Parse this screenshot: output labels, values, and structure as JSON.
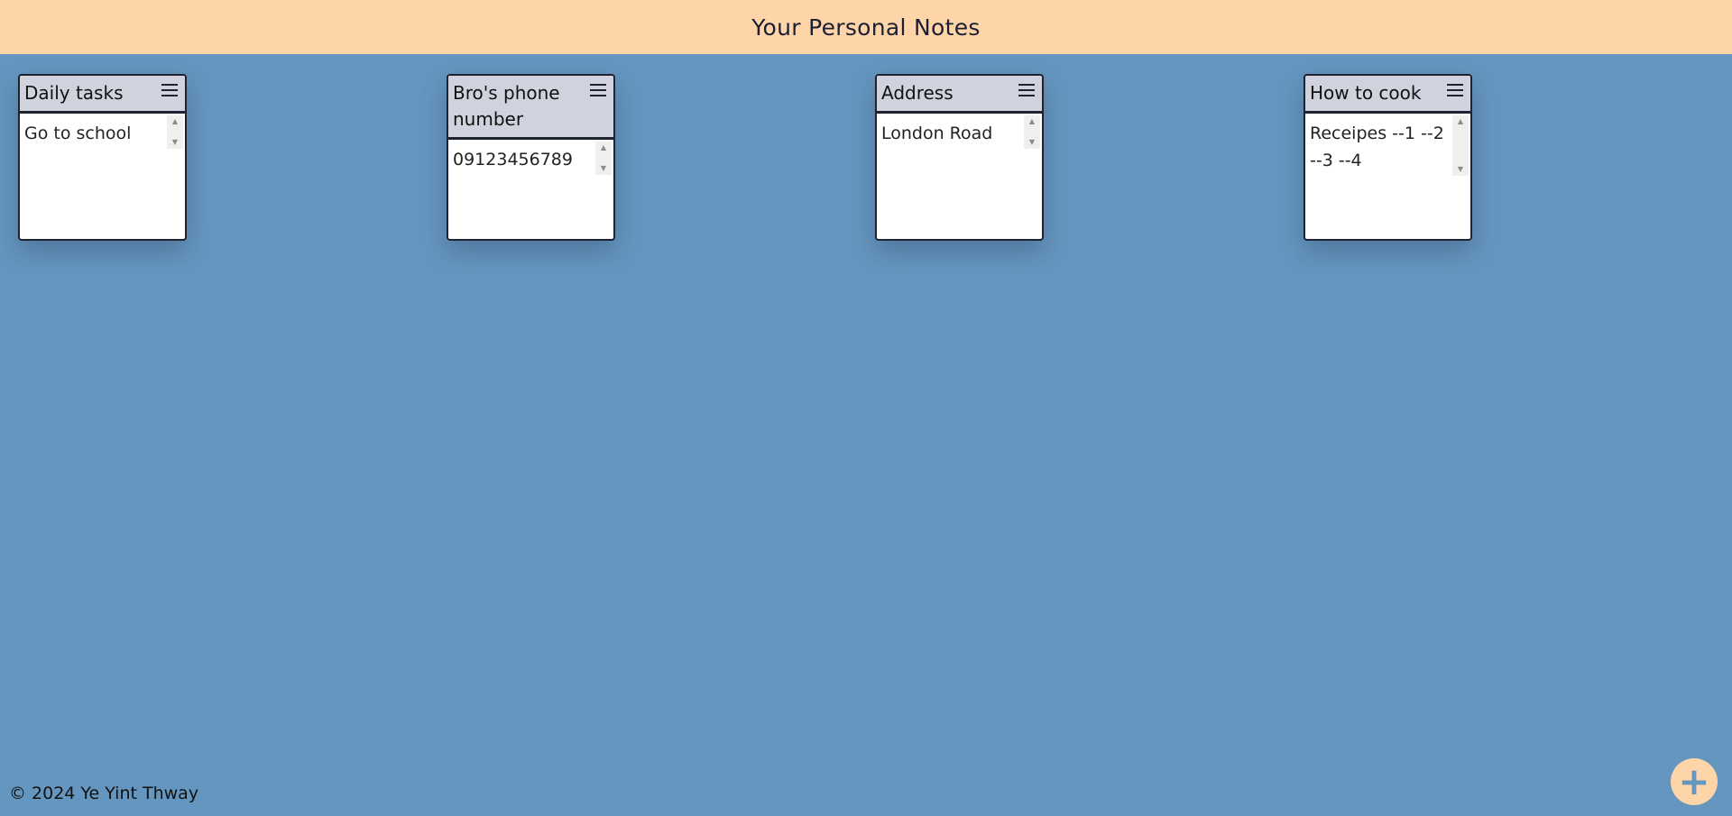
{
  "header": {
    "title": "Your Personal Notes"
  },
  "notes": [
    {
      "title": "Daily tasks",
      "content": "Go to school"
    },
    {
      "title": "Bro's phone number",
      "content": "09123456789"
    },
    {
      "title": "Address",
      "content": "London Road"
    },
    {
      "title": "How to cook",
      "content": "Receipes --1 --2 --3 --4"
    }
  ],
  "icons": {
    "note_menu": "hamburger-menu-icon",
    "add": "plus-icon"
  },
  "footer": {
    "text": "© 2024 Ye Yint Thway"
  },
  "add_button": {
    "label": "+"
  },
  "colors": {
    "background": "#6596bf",
    "header": "#fed5a8",
    "note_header": "#d0d3de",
    "note_border": "#1f2230"
  }
}
